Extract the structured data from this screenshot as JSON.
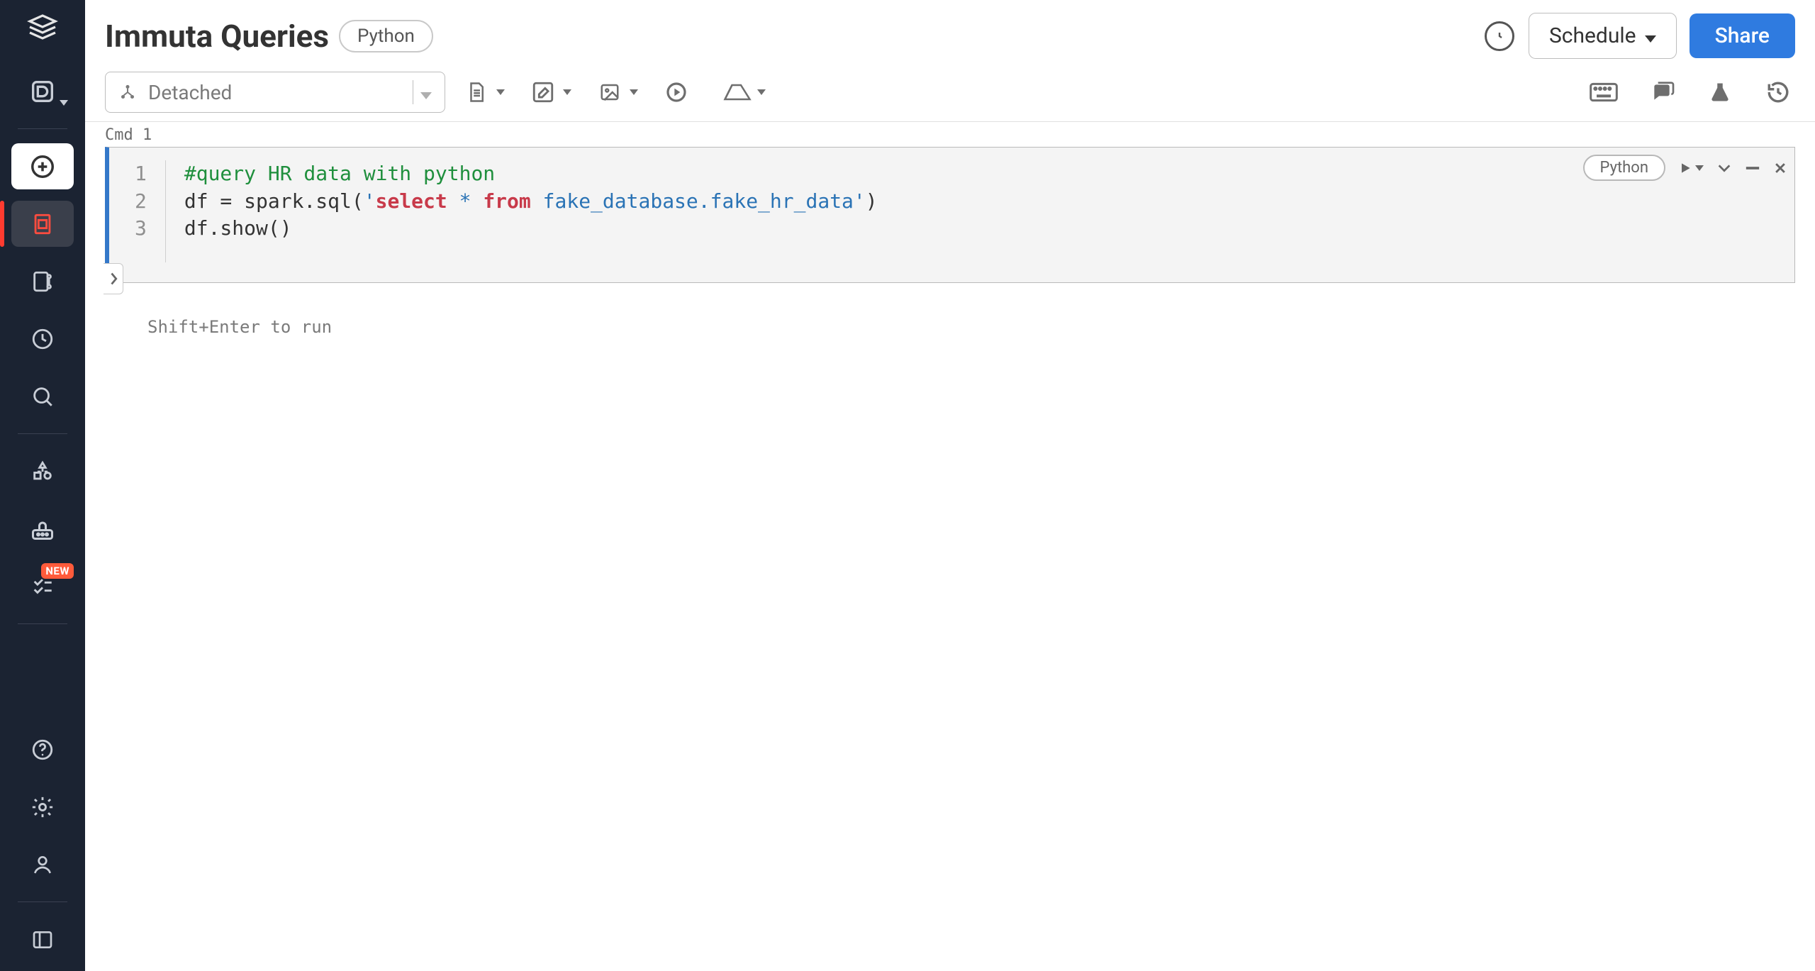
{
  "header": {
    "title": "Immuta Queries",
    "language_pill": "Python",
    "schedule_label": "Schedule",
    "share_label": "Share"
  },
  "toolbar": {
    "cluster_state": "Detached"
  },
  "cell": {
    "cmd_label": "Cmd 1",
    "lang_pill": "Python",
    "line_numbers": [
      "1",
      "2",
      "3"
    ],
    "code": {
      "l1_comment": "#query HR data with python",
      "l2_pre": "df = spark.sql(",
      "l2_q1": "'",
      "l2_kw1": "select",
      "l2_mid1": " * ",
      "l2_kw2": "from",
      "l2_mid2": " fake_database.fake_hr_data",
      "l2_q2": "'",
      "l2_post": ")",
      "l3": "df.show()"
    },
    "hint": "Shift+Enter to run"
  },
  "sidebar": {
    "new_badge": "NEW"
  }
}
